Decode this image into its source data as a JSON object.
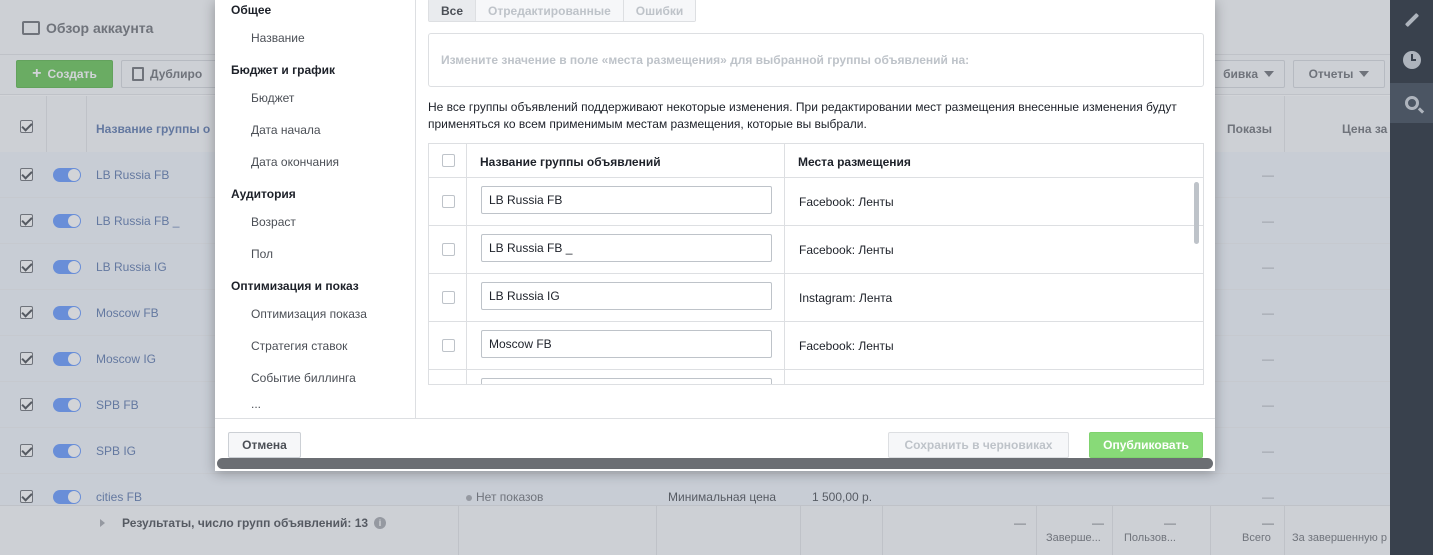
{
  "background": {
    "header_title": "Обзор аккаунта",
    "toolbar": {
      "create_label": "Создать",
      "duplicate_label": "Дублиро",
      "breakdown_label": "бивка",
      "reports_label": "Отчеты"
    },
    "table_header": {
      "name": "Название группы о",
      "shows": "Показы",
      "price": "Цена за"
    },
    "rows": [
      {
        "name": "LB Russia FB",
        "dash": "—"
      },
      {
        "name": "LB Russia FB _",
        "dash": "—"
      },
      {
        "name": "LB Russia IG",
        "dash": "—"
      },
      {
        "name": "Moscow FB",
        "dash": "—"
      },
      {
        "name": "Moscow IG",
        "dash": "—"
      },
      {
        "name": "SPB FB",
        "dash": "—"
      },
      {
        "name": "SPB IG",
        "dash": "—"
      },
      {
        "name": "cities FB",
        "dash": "—",
        "status": "Нет показов",
        "strategy": "Минимальная цена",
        "budget": "1 500,00 р."
      }
    ],
    "footer": {
      "results": "Результаты, число групп объявлений: 13",
      "info_icon": "i",
      "dash": "—",
      "completed_1": "Заверше...",
      "user_1": "Пользов...",
      "total": "Всего",
      "completed_2": "За завершенную р"
    }
  },
  "modal": {
    "sidebar": {
      "groups": [
        {
          "label": "Общее",
          "items": [
            "Название"
          ]
        },
        {
          "label": "Бюджет и график",
          "items": [
            "Бюджет",
            "Дата начала",
            "Дата окончания"
          ]
        },
        {
          "label": "Аудитория",
          "items": [
            "Возраст",
            "Пол"
          ]
        },
        {
          "label": "Оптимизация и показ",
          "items": [
            "Оптимизация показа",
            "Стратегия ставок",
            "Событие биллинга",
            "..."
          ]
        }
      ]
    },
    "tabs": [
      "Все",
      "Отредактированные",
      "Ошибки"
    ],
    "active_tab": "Все",
    "change_input_placeholder": "Измените значение в поле «места размещения» для выбранной группы объявлений на:",
    "note": "Не все группы объявлений поддерживают некоторые изменения. При редактировании мест размещения внесенные изменения будут применяться ко всем применимым местам размещения, которые вы выбрали.",
    "grid": {
      "headers": {
        "name": "Название группы объявлений",
        "placements": "Места размещения"
      },
      "rows": [
        {
          "name": "LB Russia FB",
          "placement": "Facebook: Ленты"
        },
        {
          "name": "LB Russia FB _",
          "placement": "Facebook: Ленты"
        },
        {
          "name": "LB Russia IG",
          "placement": "Instagram: Лента"
        },
        {
          "name": "Moscow FB",
          "placement": "Facebook: Ленты"
        }
      ]
    },
    "footer": {
      "cancel": "Отмена",
      "save_draft": "Сохранить в черновиках",
      "publish": "Опубликовать"
    }
  },
  "colors": {
    "primary_green": "#42b72a",
    "link_blue": "#365899",
    "toggle_blue": "#4080ff",
    "publish_disabled_green": "#88da78",
    "rail_dark": "#39414d"
  },
  "icons": {
    "rail": [
      "pencil-icon",
      "clock-icon",
      "search-chart-icon"
    ]
  }
}
